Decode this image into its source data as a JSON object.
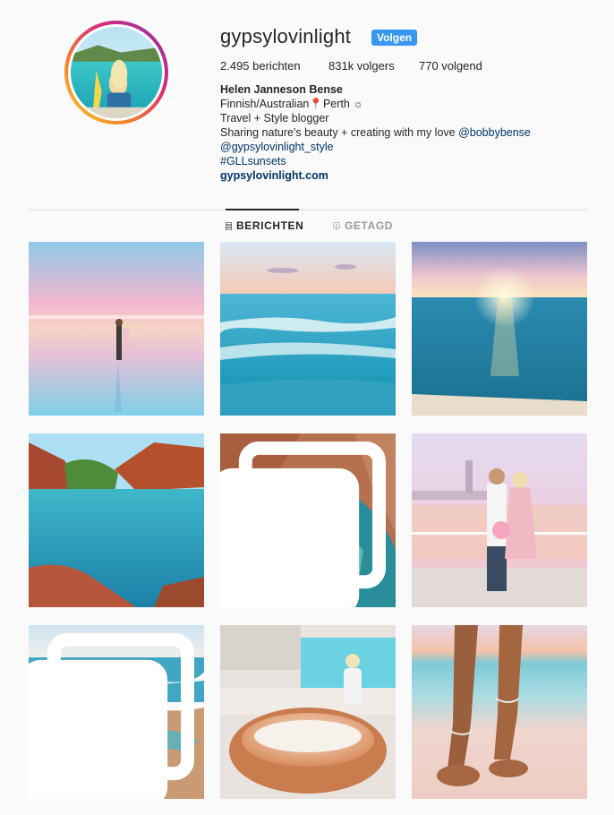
{
  "profile": {
    "username": "gypsylovinlight",
    "follow_label": "Volgen",
    "stats": {
      "posts": "2.495 berichten",
      "followers": "831k volgers",
      "following": "770 volgend"
    },
    "bio": {
      "full_name": "Helen Janneson Bense",
      "line1_text": "Finnish/Australian",
      "line1_emoji": "📍",
      "line1_city": "Perth",
      "line1_sun": "☼",
      "line2": "Travel + Style blogger",
      "line3_text": "Sharing nature's beauty + creating with my love ",
      "line3_link": "@bobbybense",
      "line4": "@gypsylovinlight_style",
      "line5": "#GLLsunsets",
      "website": "gypsylovinlight.com"
    }
  },
  "tabs": {
    "posts_label": "BERICHTEN",
    "tagged_label": "GETAGD"
  },
  "colors": {
    "accent": "#3897f0",
    "link": "#003569",
    "text": "#262626",
    "muted": "#999999",
    "divider": "#dbdbdb"
  },
  "icons": {
    "posts_tab": "grid-icon",
    "tagged_tab": "tag-icon",
    "multi_post": "carousel-icon"
  }
}
